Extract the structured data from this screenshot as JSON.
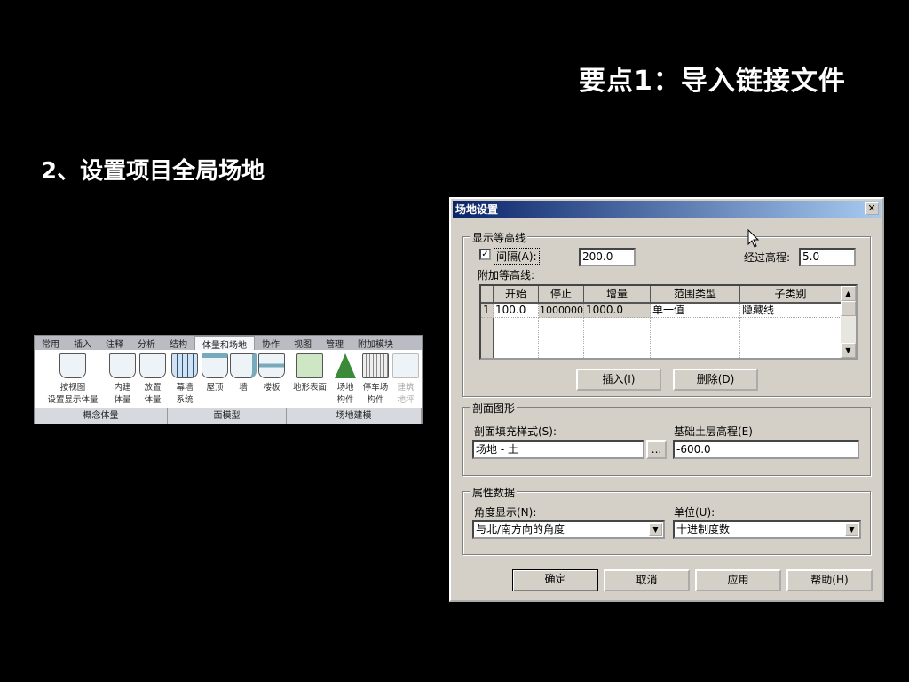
{
  "slide": {
    "title": "要点1：导入链接文件",
    "subtitle": "2、设置项目全局场地"
  },
  "ribbon": {
    "tabs": [
      "常用",
      "插入",
      "注释",
      "分析",
      "结构",
      "体量和场地",
      "协作",
      "视图",
      "管理",
      "附加模块"
    ],
    "active_tab": "体量和场地",
    "tools": [
      {
        "l1": "按视图",
        "l2": "设置显示体量"
      },
      {
        "l1": "内建",
        "l2": "体量"
      },
      {
        "l1": "放置",
        "l2": "体量"
      },
      {
        "l1": "幕墙",
        "l2": "系统"
      },
      {
        "l1": "屋顶",
        "l2": ""
      },
      {
        "l1": "墙",
        "l2": ""
      },
      {
        "l1": "楼板",
        "l2": ""
      },
      {
        "l1": "地形表面",
        "l2": ""
      },
      {
        "l1": "场地",
        "l2": "构件"
      },
      {
        "l1": "停车场",
        "l2": "构件"
      },
      {
        "l1": "建筑",
        "l2": "地坪"
      }
    ],
    "panels": [
      "概念体量",
      "面模型",
      "场地建模"
    ]
  },
  "dialog": {
    "title": "场地设置",
    "contour": {
      "legend": "显示等高线",
      "interval_label": "间隔(A):",
      "interval_checked": true,
      "interval_value": "200.0",
      "pass_label": "经过高程:",
      "pass_value": "5.0",
      "additional_label": "附加等高线:",
      "columns": [
        "开始",
        "停止",
        "增量",
        "范围类型",
        "子类别"
      ],
      "rows": [
        {
          "n": "1",
          "cells": [
            "100.0",
            "1000000",
            "1000.0",
            "单一值",
            "隐藏线"
          ]
        }
      ],
      "insert_label": "插入(I)",
      "delete_label": "删除(D)"
    },
    "section": {
      "legend": "剖面图形",
      "fill_label": "剖面填充样式(S):",
      "fill_value": "场地 - 土",
      "browse_label": "...",
      "base_label": "基础土层高程(E)",
      "base_value": "-600.0"
    },
    "property": {
      "legend": "属性数据",
      "angle_label": "角度显示(N):",
      "angle_value": "与北/南方向的角度",
      "unit_label": "单位(U):",
      "unit_value": "十进制度数"
    },
    "buttons": {
      "ok": "确定",
      "cancel": "取消",
      "apply": "应用",
      "help": "帮助(H)"
    },
    "close": "✕"
  }
}
